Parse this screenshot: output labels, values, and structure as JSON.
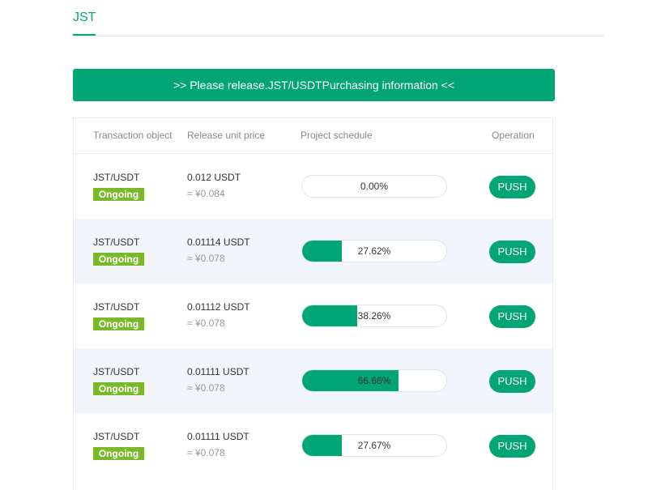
{
  "tab": {
    "label": "JST"
  },
  "banner": {
    "text": ">>  Please release.JST/USDTPurchasing information  <<"
  },
  "columns": {
    "object": "Transaction object",
    "price": "Release unit price",
    "schedule": "Project schedule",
    "operation": "Operation"
  },
  "colors": {
    "accent": "#02a574",
    "badge": "#7ab82a",
    "alt_row": "#f2f5fa"
  },
  "rows": [
    {
      "pair": "JST/USDT",
      "status": "Ongoing",
      "price": "0.012 USDT",
      "approx": "≈ ¥0.084",
      "progress_text": "0.00%",
      "progress_fraction": 0.0,
      "action": "PUSH"
    },
    {
      "pair": "JST/USDT",
      "status": "Ongoing",
      "price": "0.01114 USDT",
      "approx": "≈ ¥0.078",
      "progress_text": "27.62%",
      "progress_fraction": 0.2762,
      "action": "PUSH"
    },
    {
      "pair": "JST/USDT",
      "status": "Ongoing",
      "price": "0.01112 USDT",
      "approx": "≈ ¥0.078",
      "progress_text": "38.26%",
      "progress_fraction": 0.3826,
      "action": "PUSH"
    },
    {
      "pair": "JST/USDT",
      "status": "Ongoing",
      "price": "0.01111 USDT",
      "approx": "≈ ¥0.078",
      "progress_text": "66.66%",
      "progress_fraction": 0.6666,
      "action": "PUSH"
    },
    {
      "pair": "JST/USDT",
      "status": "Ongoing",
      "price": "0.01111 USDT",
      "approx": "≈ ¥0.078",
      "progress_text": "27.67%",
      "progress_fraction": 0.2767,
      "action": "PUSH"
    }
  ]
}
